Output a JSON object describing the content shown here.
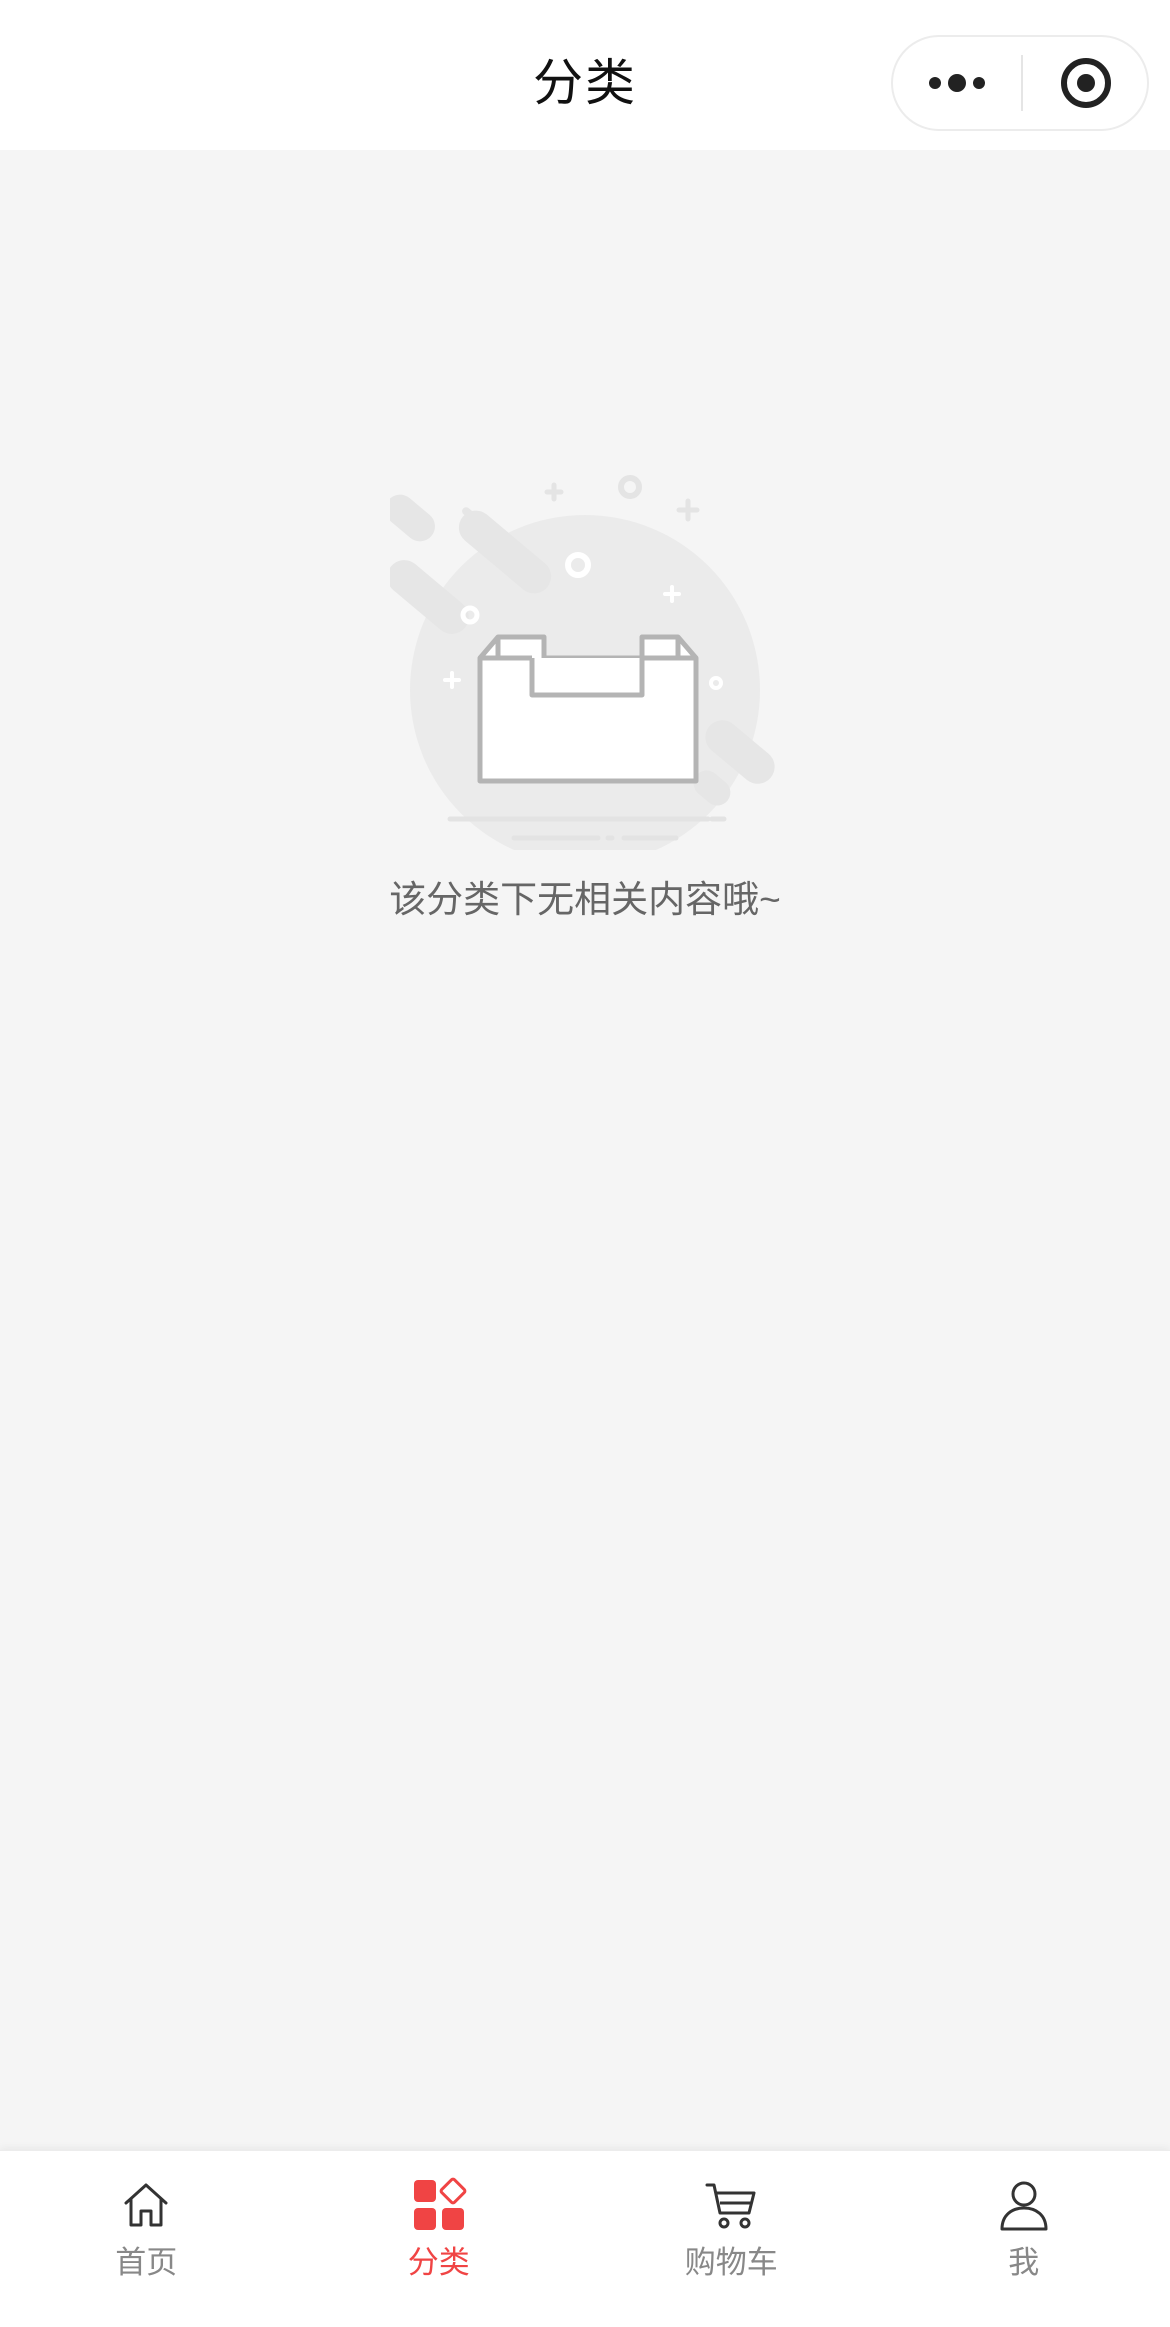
{
  "header": {
    "title": "分类",
    "more_icon": "more-dots-icon",
    "close_icon": "target-close-icon"
  },
  "empty_state": {
    "illustration": "empty-box-illustration",
    "message": "该分类下无相关内容哦~"
  },
  "tabbar": {
    "active_color": "#f04444",
    "inactive_color": "#888888",
    "tabs": [
      {
        "label": "首页",
        "icon": "home-icon",
        "active": false
      },
      {
        "label": "分类",
        "icon": "category-icon",
        "active": true
      },
      {
        "label": "购物车",
        "icon": "cart-icon",
        "active": false
      },
      {
        "label": "我",
        "icon": "user-icon",
        "active": false
      }
    ]
  }
}
